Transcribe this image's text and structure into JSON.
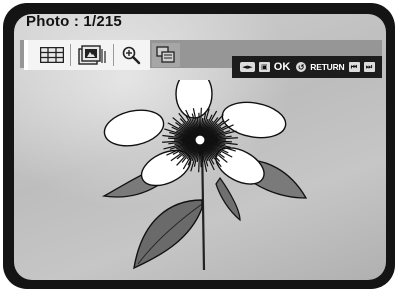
{
  "screen": {
    "title": "Photo : 1/215"
  },
  "toolbar": {
    "buttons": [
      {
        "name": "thumbnail-grid",
        "icon": "grid-icon"
      },
      {
        "name": "slideshow",
        "icon": "photo-frame-icon"
      },
      {
        "name": "zoom",
        "icon": "zoom-in-icon"
      },
      {
        "name": "copy",
        "icon": "copy-icon"
      }
    ]
  },
  "hints": {
    "nav_icon": "◄►",
    "ok_label": "OK",
    "return_label": "RETURN",
    "prev_icon": "⏮",
    "next_icon": "⏭"
  },
  "colors": {
    "bezel": "#141414",
    "screen": "#c4c4c4",
    "toolbar_band": "#969696",
    "hint_bar": "#1c1c1c"
  },
  "photo": {
    "subject": "flower-photo"
  }
}
